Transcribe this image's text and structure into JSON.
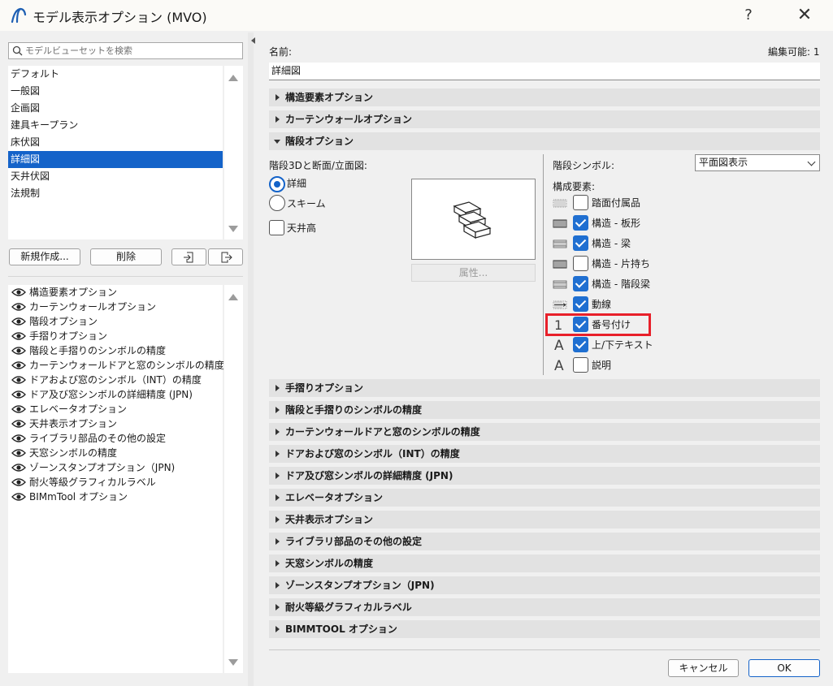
{
  "window": {
    "title": "モデル表示オプション (MVO)",
    "help": "?",
    "close": "✕"
  },
  "left": {
    "search_placeholder": "モデルビューセットを検索",
    "views": [
      "デフォルト",
      "一般図",
      "企画図",
      "建具キープラン",
      "床伏図",
      "詳細図",
      "天井伏図",
      "法規制"
    ],
    "selected_view": "詳細図",
    "new_button": "新規作成...",
    "delete_button": "削除",
    "options": [
      "構造要素オプション",
      "カーテンウォールオプション",
      "階段オプション",
      "手摺りオプション",
      "階段と手摺りのシンボルの精度",
      "カーテンウォールドアと窓のシンボルの精度",
      "ドアおよび窓のシンボル（INT）の精度",
      "ドア及び窓シンボルの詳細精度 (JPN)",
      "エレベータオプション",
      "天井表示オプション",
      "ライブラリ部品のその他の設定",
      "天窓シンボルの精度",
      "ゾーンスタンプオプション（JPN)",
      "耐火等級グラフィカルラベル",
      "BIMmTool オプション"
    ]
  },
  "right": {
    "name_label": "名前:",
    "editable": "編集可能: 1",
    "name_value": "詳細図",
    "sections_top": [
      "構造要素オプション",
      "カーテンウォールオプション"
    ],
    "stair_section": "階段オプション",
    "stair": {
      "display_label": "階段3Dと断面/立面図:",
      "radio_detail": "詳細",
      "radio_scheme": "スキーム",
      "ceiling_height": "天井高",
      "properties_button": "属性...",
      "symbol_label": "階段シンボル:",
      "symbol_value": "平面図表示",
      "components_label": "構成要素:",
      "components": [
        {
          "label": "踏面付属品",
          "checked": false
        },
        {
          "label": "構造 - 板形",
          "checked": true
        },
        {
          "label": "構造 - 梁",
          "checked": true
        },
        {
          "label": "構造 - 片持ち",
          "checked": false
        },
        {
          "label": "構造 - 階段梁",
          "checked": true
        },
        {
          "label": "動線",
          "checked": true
        },
        {
          "label": "番号付け",
          "checked": true
        },
        {
          "label": "上/下テキスト",
          "checked": true
        },
        {
          "label": "説明",
          "checked": false
        }
      ],
      "number_glyph": "1",
      "text_glyph": "A"
    },
    "sections_bottom": [
      "手摺りオプション",
      "階段と手摺りのシンボルの精度",
      "カーテンウォールドアと窓のシンボルの精度",
      "ドアおよび窓のシンボル（INT）の精度",
      "ドア及び窓シンボルの詳細精度 (JPN)",
      "エレベータオプション",
      "天井表示オプション",
      "ライブラリ部品のその他の設定",
      "天窓シンボルの精度",
      "ゾーンスタンプオプション（JPN)",
      "耐火等級グラフィカルラベル",
      "BIMMTOOL オプション"
    ],
    "cancel_button": "キャンセル",
    "ok_button": "OK"
  },
  "colors": {
    "accent": "#1463c9",
    "highlight": "#e8202a"
  }
}
